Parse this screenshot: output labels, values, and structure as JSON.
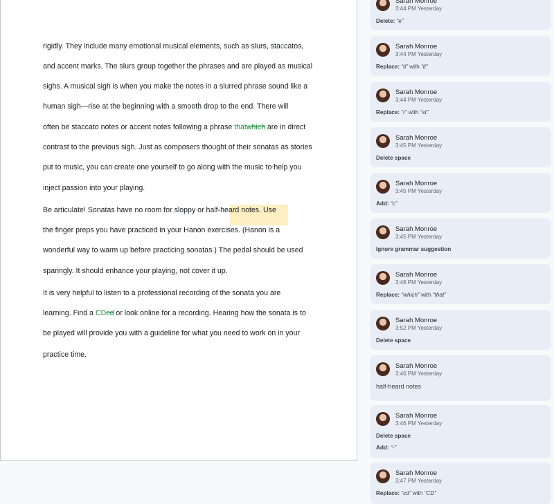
{
  "document": {
    "lines": [
      {
        "parts": [
          {
            "t": "rigidly. They include many emotional musical elements, such as slurs, sta"
          },
          {
            "t": "c",
            "s": "ins"
          },
          {
            "t": "catos,"
          }
        ]
      },
      {
        "parts": [
          {
            "t": "and accent marks. The slurs group together the phrases and are played as musical"
          }
        ]
      },
      {
        "parts": [
          {
            "t": "sighs. A musical sigh is when you make the notes in a slurred phrase sound like a"
          }
        ]
      },
      {
        "parts": [
          {
            "t": "human sigh—rise at the beginning with a smooth drop to the end. There will"
          }
        ]
      },
      {
        "parts": [
          {
            "t": "often be staccato notes or accent notes following a phrase "
          },
          {
            "t": "that",
            "s": "ins"
          },
          {
            "t": "which",
            "s": "del"
          },
          {
            "t": " are in direct"
          }
        ]
      },
      {
        "parts": [
          {
            "t": "contrast to the previous sigh. Just as composers thought of their sonatas as stories"
          }
        ]
      },
      {
        "parts": [
          {
            "t": "put to music, you can create one yourself to go along with the music to"
          },
          {
            "t": " ",
            "s": "del"
          },
          {
            "t": "help you"
          }
        ]
      },
      {
        "parts": [
          {
            "t": "inject passion into your playing."
          }
        ]
      },
      {
        "parts": [
          {
            "t": "        Be articulate! Sonatas have no room for sloppy or "
          },
          {
            "t": "half-heard notes",
            "s": "hl"
          },
          {
            "t": ". Use"
          }
        ]
      },
      {
        "parts": [
          {
            "t": "the finger preps you have practiced in your Hanon exercises. (Hanon is a"
          }
        ]
      },
      {
        "parts": [
          {
            "t": "wonderful way to warm up before practicing sonatas.) The pedal should be used"
          }
        ]
      },
      {
        "parts": [
          {
            "t": "sparingly. It should enhance your playing, not cover it up."
          }
        ]
      },
      {
        "parts": [
          {
            "t": "        It is very helpful to listen to a professional recording of the sonata you are"
          }
        ]
      },
      {
        "parts": [
          {
            "t": "learning. Find a "
          },
          {
            "t": "CD",
            "s": "ins"
          },
          {
            "t": "cd",
            "s": "del"
          },
          {
            "t": " or look online for a recording. Hearing how the sonata is to"
          }
        ]
      },
      {
        "parts": [
          {
            "t": "be played will provide you with a guideline for what you need to work on in your"
          }
        ]
      },
      {
        "parts": [
          {
            "t": "practice time."
          }
        ]
      }
    ]
  },
  "suggestions": [
    {
      "author": "Sarah Monroe",
      "time": "3:44 PM Yesterday",
      "action": "Delete: ",
      "quoted": "“e”"
    },
    {
      "author": "Sarah Monroe",
      "time": "3:44 PM Yesterday",
      "action": "Replace: ",
      "quoted": "“ti”",
      "mid": " with ",
      "quoted2": "“it”"
    },
    {
      "author": "Sarah Monroe",
      "time": "3:44 PM Yesterday",
      "action": "Replace: ",
      "quoted": "“r”",
      "mid": " with ",
      "quoted2": "“st”"
    },
    {
      "author": "Sarah Monroe",
      "time": "3:45 PM Yesterday",
      "action": "Delete space"
    },
    {
      "author": "Sarah Monroe",
      "time": "3:45 PM Yesterday",
      "action": "Add: ",
      "quoted": "“c”"
    },
    {
      "author": "Sarah Monroe",
      "time": "3:45 PM Yesterday",
      "action": "Ignore grammar suggestion"
    },
    {
      "author": "Sarah Monroe",
      "time": "3:46 PM Yesterday",
      "action": "Replace: ",
      "quoted": "“which”",
      "mid": " with ",
      "quoted2": "“that”"
    },
    {
      "author": "Sarah Monroe",
      "time": "3:52 PM Yesterday",
      "action": "Delete space"
    },
    {
      "author": "Sarah Monroe",
      "time": "3:46 PM Yesterday",
      "comment": "half-heard notes"
    },
    {
      "author": "Sarah Monroe",
      "time": "3:46 PM Yesterday",
      "action": "Delete space",
      "action2": "Add: ",
      "quoted_b": "“-”"
    },
    {
      "author": "Sarah Monroe",
      "time": "3:47 PM Yesterday",
      "action": "Replace: ",
      "quoted": "“cd”",
      "mid": " with ",
      "quoted2": "“CD”"
    }
  ]
}
